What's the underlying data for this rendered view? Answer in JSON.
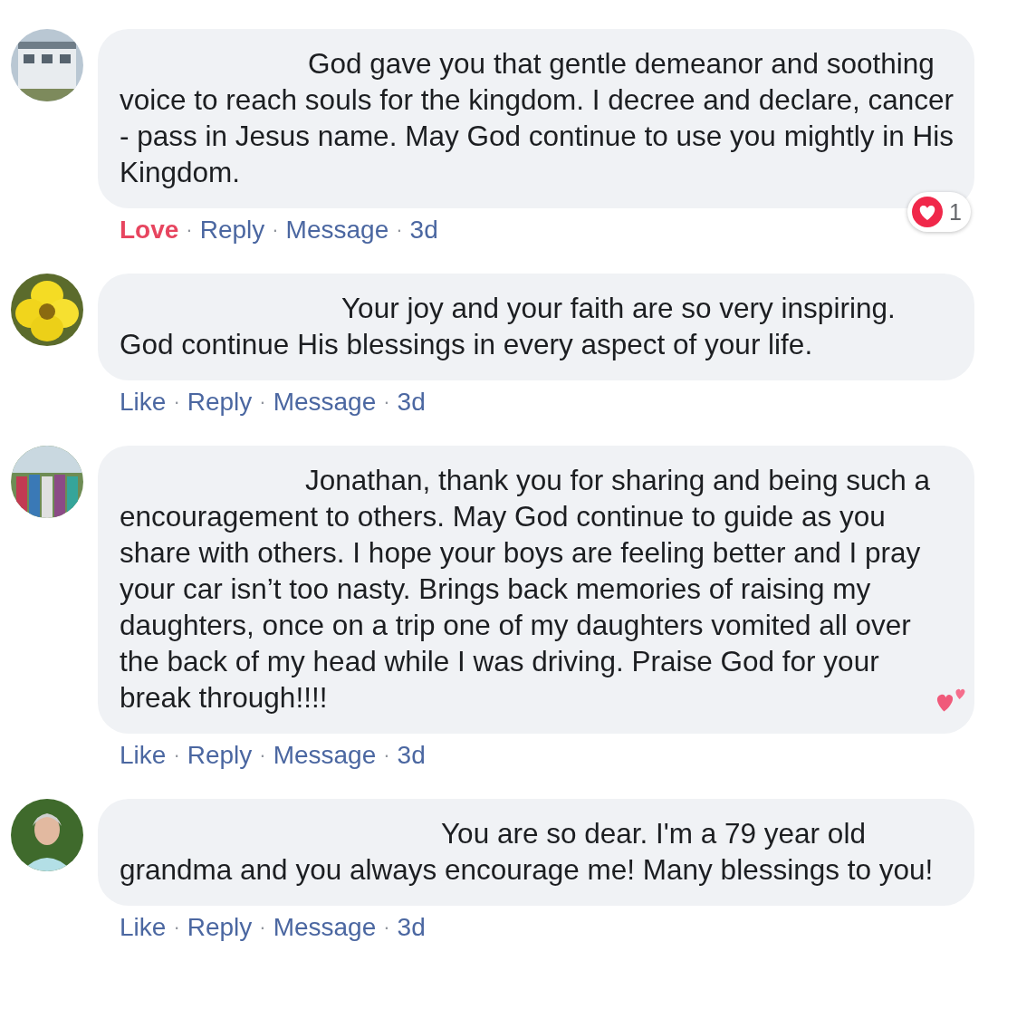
{
  "comments": [
    {
      "text": "God gave you that gentle demeanor and soothing voice to reach souls for the kingdom. I decree and declare, cancer - pass in Jesus name. May God continue to use you mightly in His Kingdom.",
      "has_emoji": false,
      "reactions": {
        "count": "1"
      },
      "footer": [
        {
          "kind": "reaction",
          "label": "Love",
          "active": true
        },
        {
          "kind": "sep",
          "text": "·"
        },
        {
          "kind": "link",
          "label": "Reply"
        },
        {
          "kind": "sep",
          "text": "·"
        },
        {
          "kind": "link",
          "label": "Message"
        },
        {
          "kind": "sep",
          "text": "·"
        },
        {
          "kind": "time",
          "label": "3d"
        }
      ]
    },
    {
      "text": "Your joy and your faith are so very inspiring. God continue His blessings in every aspect of your life.",
      "has_emoji": false,
      "footer": [
        {
          "kind": "reaction",
          "label": "Like",
          "active": false
        },
        {
          "kind": "sep",
          "text": "·"
        },
        {
          "kind": "link",
          "label": "Reply"
        },
        {
          "kind": "sep",
          "text": "·"
        },
        {
          "kind": "link",
          "label": "Message"
        },
        {
          "kind": "sep",
          "text": "·"
        },
        {
          "kind": "time",
          "label": "3d"
        }
      ]
    },
    {
      "text": "Jonathan, thank you for sharing and being such a encouragement to others. May God continue to guide as you share with others. I hope your boys are feeling better and I pray your car isn’t too nasty. Brings back memories of raising my daughters, once on a trip one of my daughters vomited all over the back of my head while I was driving. Praise God for your break through!!!!",
      "has_emoji": true,
      "footer": [
        {
          "kind": "reaction",
          "label": "Like",
          "active": false
        },
        {
          "kind": "sep",
          "text": "·"
        },
        {
          "kind": "link",
          "label": "Reply"
        },
        {
          "kind": "sep",
          "text": "·"
        },
        {
          "kind": "link",
          "label": "Message"
        },
        {
          "kind": "sep",
          "text": "·"
        },
        {
          "kind": "time",
          "label": "3d"
        }
      ]
    },
    {
      "text": "You are so dear. I'm a 79 year old grandma and you always encourage me! Many blessings to you!",
      "has_emoji": false,
      "footer": [
        {
          "kind": "reaction",
          "label": "Like",
          "active": false
        },
        {
          "kind": "sep",
          "text": "·"
        },
        {
          "kind": "link",
          "label": "Reply"
        },
        {
          "kind": "sep",
          "text": "·"
        },
        {
          "kind": "link",
          "label": "Message"
        },
        {
          "kind": "sep",
          "text": "·"
        },
        {
          "kind": "time",
          "label": "3d"
        }
      ]
    }
  ]
}
